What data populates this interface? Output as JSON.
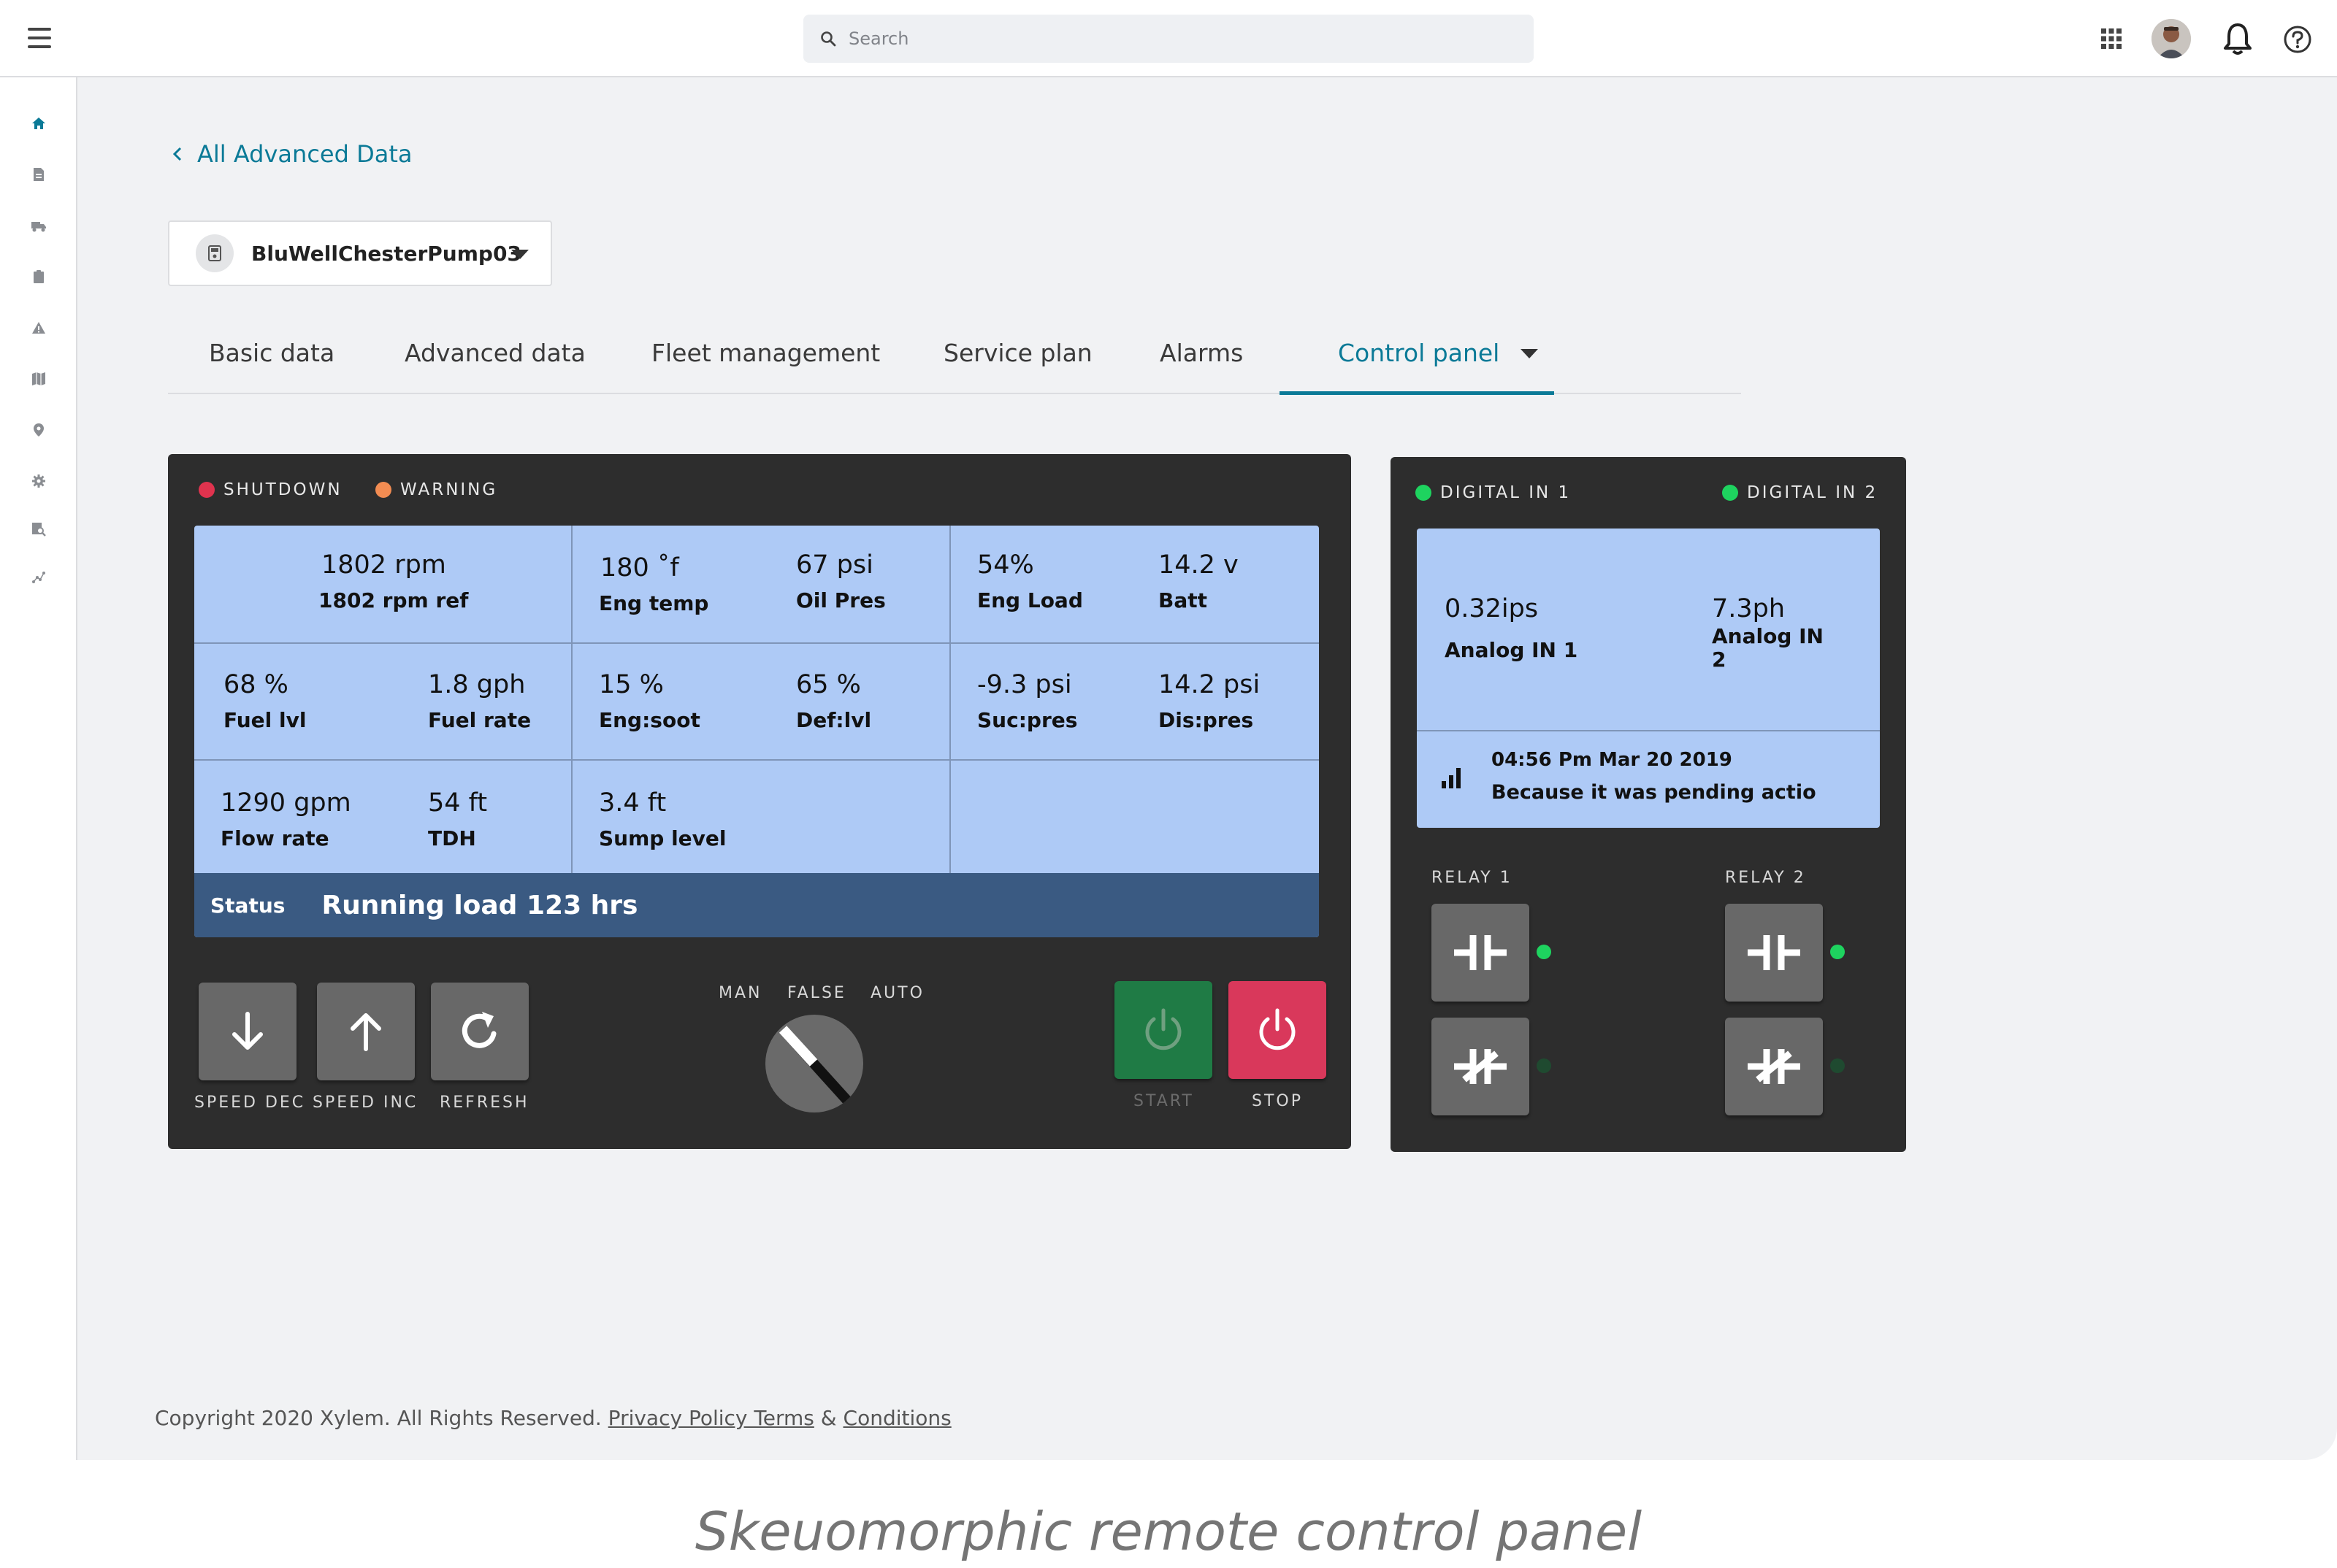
{
  "topbar": {
    "search_placeholder": "Search"
  },
  "breadcrumb": {
    "back_label": "All Advanced Data"
  },
  "device": {
    "name": "BluWellChesterPump03"
  },
  "tabs": [
    "Basic data",
    "Advanced data",
    "Fleet management",
    "Service plan",
    "Alarms",
    "Control panel"
  ],
  "active_tab": "Control panel",
  "control": {
    "indicators": {
      "shutdown": "SHUTDOWN",
      "warning": "WARNING"
    },
    "colors": {
      "shutdown": "#e0334e",
      "warning": "#f28c52",
      "screen": "#aecaf6",
      "status_bar": "#3a5a82",
      "start": "#1f7b45",
      "stop": "#d9385b"
    },
    "readings": [
      {
        "value": "1802 rpm",
        "label": "1802 rpm ref"
      },
      {
        "value": "180 ˚f",
        "label": "Eng temp"
      },
      {
        "value": "67 psi",
        "label": "Oil Pres"
      },
      {
        "value": "54%",
        "label": "Eng Load"
      },
      {
        "value": "14.2 v",
        "label": "Batt"
      },
      {
        "value": "68 %",
        "label": "Fuel lvl"
      },
      {
        "value": "1.8 gph",
        "label": "Fuel rate"
      },
      {
        "value": "15 %",
        "label": "Eng:soot"
      },
      {
        "value": "65 %",
        "label": "Def:lvl"
      },
      {
        "value": "-9.3 psi",
        "label": "Suc:pres"
      },
      {
        "value": "14.2 psi",
        "label": "Dis:pres"
      },
      {
        "value": "1290 gpm",
        "label": "Flow rate"
      },
      {
        "value": "54 ft",
        "label": "TDH"
      },
      {
        "value": "3.4 ft",
        "label": "Sump level"
      }
    ],
    "status": {
      "label": "Status",
      "value": "Running load 123 hrs"
    },
    "buttons": {
      "speed_dec": "SPEED DEC",
      "speed_inc": "SPEED INC",
      "refresh": "REFRESH",
      "start": "START",
      "stop": "STOP"
    },
    "mode_options": [
      "MAN",
      "FALSE",
      "AUTO"
    ]
  },
  "io": {
    "digital_in_1": "DIGITAL IN 1",
    "digital_in_2": "DIGITAL IN 2",
    "analog": [
      {
        "value": "0.32ips",
        "label": "Analog IN 1"
      },
      {
        "value": "7.3ph",
        "label": "Analog IN 2"
      }
    ],
    "event": {
      "time": "04:56 Pm Mar 20 2019",
      "message": "Because it was pending actio"
    },
    "relay_1": "RELAY 1",
    "relay_2": "RELAY 2",
    "colors": {
      "led_on": "#1ed35f",
      "led_off": "#1f4a30"
    }
  },
  "footer": {
    "copyright": "Copyright 2020 Xylem. All Rights Reserved.",
    "privacy_link": "Privacy Policy Terms",
    "amp": "&",
    "conditions_link": "Conditions"
  },
  "caption": "Skeuomorphic remote control panel"
}
